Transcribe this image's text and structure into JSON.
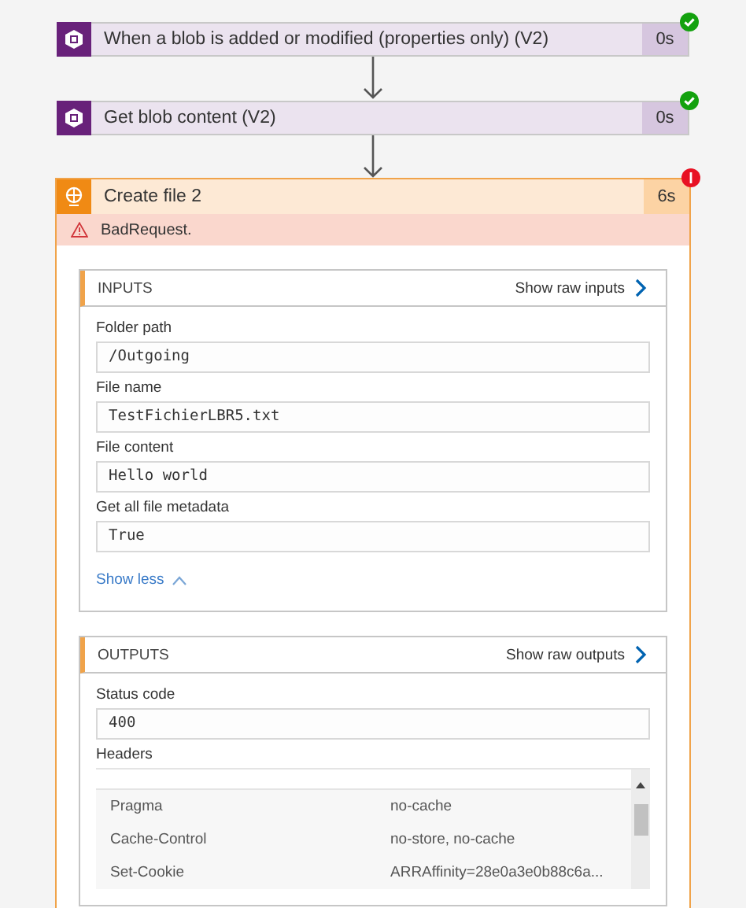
{
  "steps": [
    {
      "title": "When a blob is added or modified (properties only) (V2)",
      "duration": "0s",
      "succeeded": true
    },
    {
      "title": "Get blob content (V2)",
      "duration": "0s",
      "succeeded": true
    }
  ],
  "failed_step": {
    "title": "Create file 2",
    "duration": "6s",
    "succeeded": false,
    "error": "BadRequest.",
    "inputs": {
      "heading": "INPUTS",
      "raw_link": "Show raw inputs",
      "fields": [
        {
          "label": "Folder path",
          "value": "/Outgoing"
        },
        {
          "label": "File name",
          "value": "TestFichierLBR5.txt"
        },
        {
          "label": "File content",
          "value": "Hello world"
        },
        {
          "label": "Get all file metadata",
          "value": "True"
        }
      ],
      "toggle": "Show less",
      "expanded": true
    },
    "outputs": {
      "heading": "OUTPUTS",
      "raw_link": "Show raw outputs",
      "status_label": "Status code",
      "status_value": "400",
      "headers_label": "Headers",
      "headers": [
        {
          "key": "Pragma",
          "value": "no-cache"
        },
        {
          "key": "Cache-Control",
          "value": "no-store, no-cache"
        },
        {
          "key": "Set-Cookie",
          "value": "ARRAffinity=28e0a3e0b88c6a..."
        }
      ]
    }
  }
}
